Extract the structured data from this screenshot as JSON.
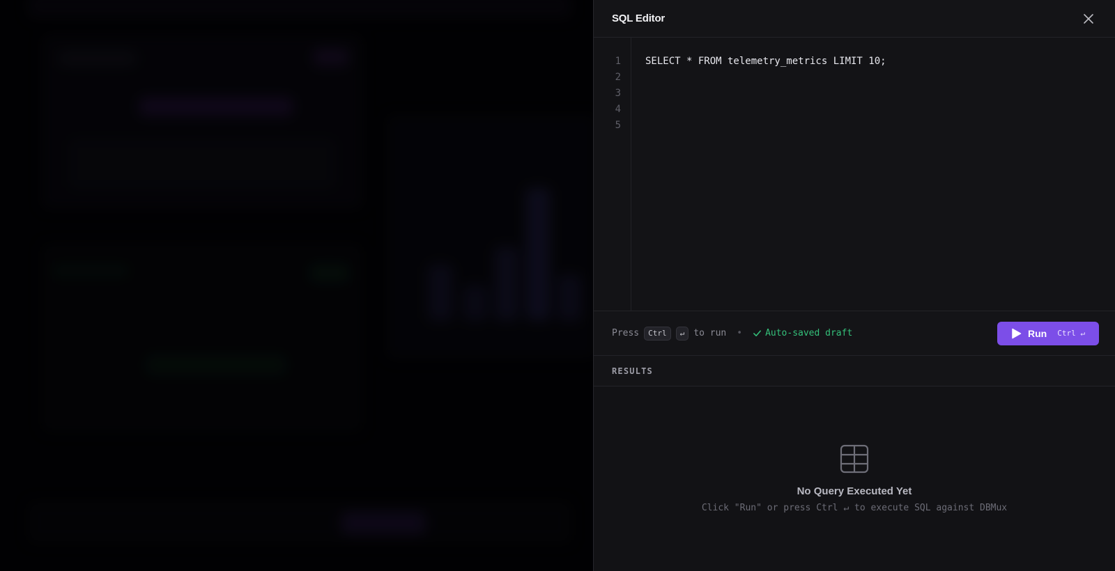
{
  "panel": {
    "title": "SQL Editor",
    "close_icon": "close-icon"
  },
  "editor": {
    "line_numbers": [
      "1",
      "2",
      "3",
      "4",
      "5"
    ],
    "lines": [
      "SELECT * FROM telemetry_metrics LIMIT 10;",
      "",
      "",
      "",
      ""
    ]
  },
  "toolbar": {
    "press_text": "Press",
    "key_ctrl": "Ctrl",
    "key_enter": "↵",
    "to_run_text": "to run",
    "separator": "•",
    "autosave_text": "Auto-saved draft",
    "run_label": "Run",
    "run_shortcut": "Ctrl ↵"
  },
  "results": {
    "title": "RESULTS",
    "empty_title": "No Query Executed Yet",
    "empty_subtitle": "Click \"Run\" or press Ctrl ↵ to execute SQL against DBMux"
  },
  "colors": {
    "accent": "#7c4ee8",
    "success": "#34c07a",
    "panel_bg": "#131316"
  }
}
